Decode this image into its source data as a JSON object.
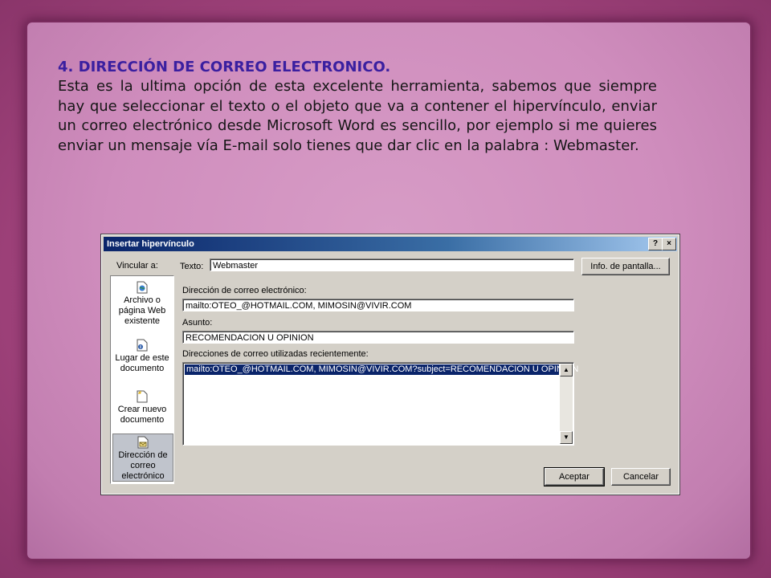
{
  "slide": {
    "heading": "4. DIRECCIÓN DE CORREO ELECTRONICO.",
    "body": "Esta es la ultima opción de esta excelente herramienta, sabemos que siempre hay que seleccionar el texto o el objeto que va a contener el hipervínculo, enviar un correo electrónico desde Microsoft Word es sencillo, por ejemplo si me quieres enviar un mensaje vía E-mail solo tienes que dar clic en la palabra : Webmaster."
  },
  "dialog": {
    "title": "Insertar hipervínculo",
    "help_button": "?",
    "close_button": "×",
    "link_to_label": "Vincular a:",
    "link_items": [
      {
        "label": "Archivo o página Web existente",
        "icon": "web-page-icon"
      },
      {
        "label": "Lugar de este documento",
        "icon": "document-place-icon"
      },
      {
        "label": "Crear nuevo documento",
        "icon": "new-document-icon"
      },
      {
        "label": "Dirección de correo electrónico",
        "icon": "email-address-icon",
        "selected": true
      }
    ],
    "text_label": "Texto:",
    "text_value": "Webmaster",
    "screen_tip_button": "Info. de pantalla...",
    "email_label": "Dirección de correo electrónico:",
    "email_value": "mailto:OTEO_@HOTMAIL.COM, MIMOSIN@VIVIR.COM",
    "subject_label": "Asunto:",
    "subject_value": "RECOMENDACION U OPINION",
    "recent_label": "Direcciones de correo utilizadas recientemente:",
    "recent_items": [
      "mailto:OTEO_@HOTMAIL.COM, MIMOSIN@VIVIR.COM?subject=RECOMENDACION U OPINION"
    ],
    "ok_button": "Aceptar",
    "cancel_button": "Cancelar"
  }
}
